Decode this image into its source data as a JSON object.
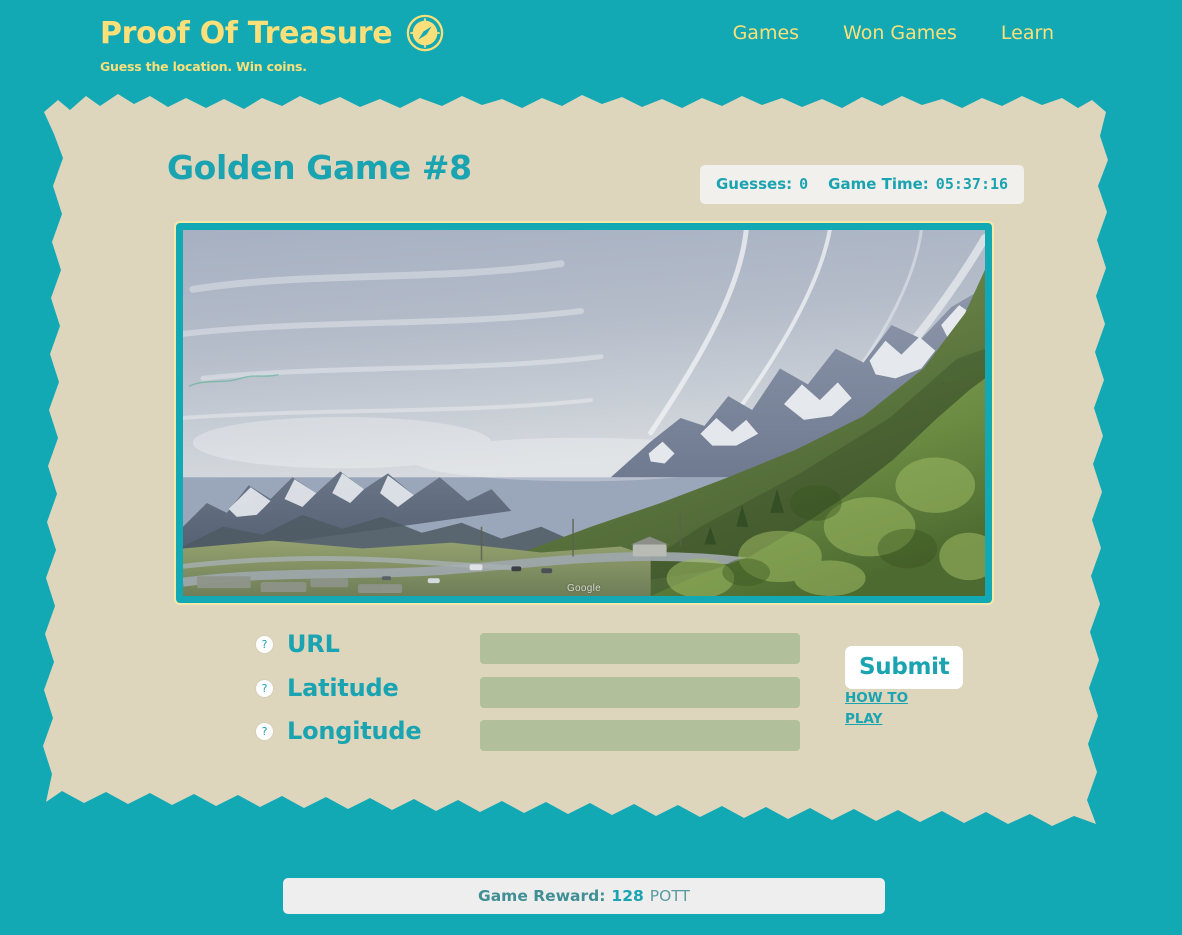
{
  "theme": {
    "teal": "#12a8b4",
    "teal_text": "#1aa3b0",
    "paper": "#ddd6bd",
    "yellow": "#fbe07a",
    "field_green": "#b1bf9b",
    "stats_bg": "#f2f0ec",
    "reward_bg": "#eeeeee"
  },
  "header": {
    "brand_title": "Proof Of Treasure",
    "tagline": "Guess the location. Win coins.",
    "logo_icon": "compass-icon",
    "nav": [
      {
        "label": "Games"
      },
      {
        "label": "Won Games"
      },
      {
        "label": "Learn"
      }
    ]
  },
  "main": {
    "game_title": "Golden Game #8",
    "stats": {
      "guesses_label": "Guesses:",
      "guesses_value": "0",
      "time_label": "Game Time:",
      "time_value": "05:37:16"
    },
    "photo": {
      "watermark": "Google",
      "alt": "Alpine mountain pass with snow-capped peaks, green slopes and a winding road"
    },
    "form": {
      "help_icon_glyph": "?",
      "fields": [
        {
          "label": "URL",
          "value": "",
          "placeholder": ""
        },
        {
          "label": "Latitude",
          "value": "",
          "placeholder": ""
        },
        {
          "label": "Longitude",
          "value": "",
          "placeholder": ""
        }
      ],
      "submit_label": "Submit",
      "how_to_play_label": "HOW TO PLAY"
    }
  },
  "footer": {
    "reward_label": "Game Reward:",
    "reward_value": "128",
    "reward_unit": "POTT"
  }
}
